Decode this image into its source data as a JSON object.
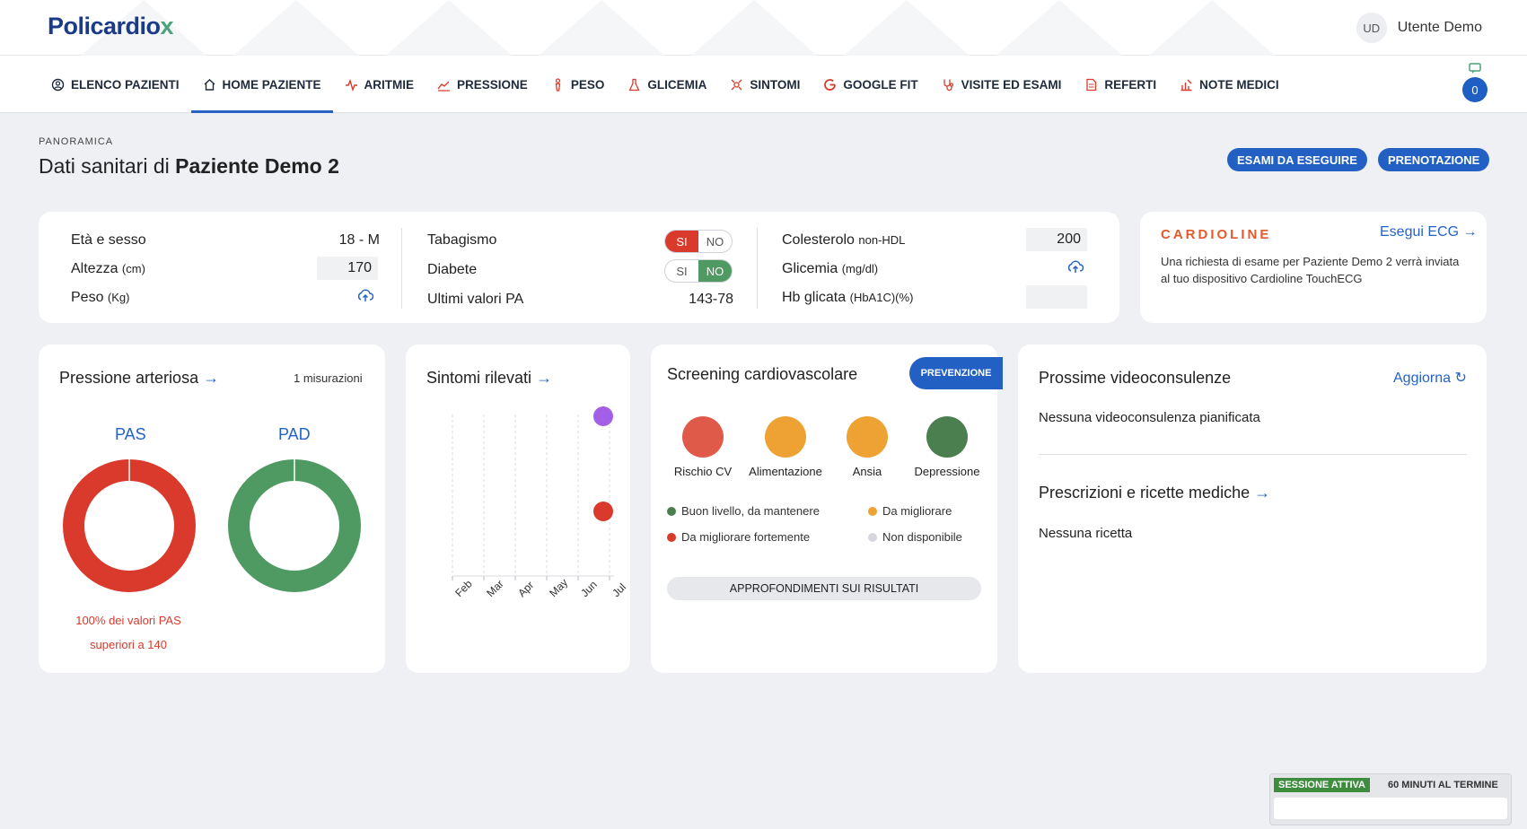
{
  "header": {
    "logo_text": "Policardio",
    "logo_mark": "x",
    "user_initials": "UD",
    "user_name": "Utente Demo"
  },
  "nav": {
    "items": [
      {
        "label": "ELENCO PAZIENTI",
        "icon": "patients-icon"
      },
      {
        "label": "HOME PAZIENTE",
        "icon": "home-icon",
        "active": true
      },
      {
        "label": "ARITMIE",
        "icon": "heartbeat-icon"
      },
      {
        "label": "PRESSIONE",
        "icon": "chart-icon"
      },
      {
        "label": "PESO",
        "icon": "person-icon"
      },
      {
        "label": "GLICEMIA",
        "icon": "flask-icon"
      },
      {
        "label": "SINTOMI",
        "icon": "symptoms-icon"
      },
      {
        "label": "GOOGLE FIT",
        "icon": "google-icon"
      },
      {
        "label": "VISITE ED ESAMI",
        "icon": "stethoscope-icon"
      },
      {
        "label": "REFERTI",
        "icon": "document-icon"
      },
      {
        "label": "NOTE MEDICI",
        "icon": "notes-icon"
      }
    ],
    "notification_count": "0"
  },
  "page": {
    "eyebrow": "PANORAMICA",
    "title_prefix": "Dati sanitari di ",
    "patient_name": "Paziente Demo 2",
    "btn_exams": "ESAMI DA ESEGUIRE",
    "btn_booking": "PRENOTAZIONE"
  },
  "summary": {
    "age_label": "Età e sesso",
    "age_value": "18 - M",
    "height_label": "Altezza",
    "height_unit": "(cm)",
    "height_value": "170",
    "weight_label": "Peso",
    "weight_unit": "(Kg)",
    "smoking_label": "Tabagismo",
    "diabetes_label": "Diabete",
    "toggle_yes": "SI",
    "toggle_no": "NO",
    "bp_label": "Ultimi valori PA",
    "bp_value": "143-78",
    "chol_label": "Colesterolo",
    "chol_unit": "non-HDL",
    "chol_value": "200",
    "gly_label": "Glicemia",
    "gly_unit": "(mg/dl)",
    "hb_label": "Hb glicata",
    "hb_unit": "(HbA1C)(%)",
    "hb_value": ""
  },
  "cardioline": {
    "brand": "CARDIOLINE",
    "action": "Esegui ECG",
    "message": "Una richiesta di esame per Paziente Demo 2 verrà inviata al tuo dispositivo Cardioline TouchECG"
  },
  "pressure": {
    "title": "Pressione arteriosa",
    "count": "1 misurazioni",
    "pas_label": "PAS",
    "pad_label": "PAD",
    "note_line1": "100% dei valori PAS",
    "note_line2": "superiori a 140",
    "pas_color": "#d93a2b",
    "pad_color": "#4f9a62"
  },
  "symptoms": {
    "title": "Sintomi rilevati",
    "months": [
      "Feb",
      "Mar",
      "Apr",
      "May",
      "Jun",
      "Jul"
    ]
  },
  "screening": {
    "title": "Screening cardiovascolare",
    "badge": "PREVENZIONE",
    "items": [
      {
        "label": "Rischio CV",
        "color": "#e05a4a"
      },
      {
        "label": "Alimentazione",
        "color": "#efa234"
      },
      {
        "label": "Ansia",
        "color": "#efa234"
      },
      {
        "label": "Depressione",
        "color": "#4b7f50"
      }
    ],
    "legend": {
      "good": "Buon livello, da mantenere",
      "improve": "Da migliorare",
      "strong": "Da migliorare fortemente",
      "na": "Non disponibile"
    },
    "button": "APPROFONDIMENTI SUI RISULTATI"
  },
  "video": {
    "title": "Prossime videoconsulenze",
    "refresh": "Aggiorna",
    "empty": "Nessuna videoconsulenza pianificata",
    "rx_title": "Prescrizioni e ricette mediche",
    "rx_empty": "Nessuna ricetta"
  },
  "session": {
    "status": "SESSIONE ATTIVA",
    "remaining": "60 MINUTI AL TERMINE"
  }
}
